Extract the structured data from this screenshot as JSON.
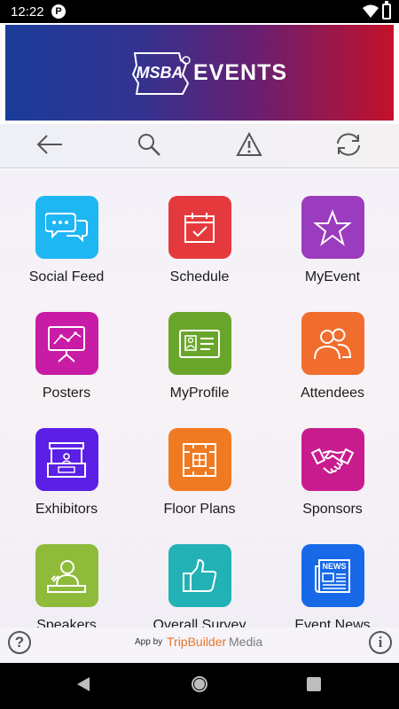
{
  "status_bar": {
    "time": "12:22",
    "app_badge": "P"
  },
  "banner": {
    "logo_text": "MSBA",
    "title": "EVENTS"
  },
  "toolbar": {
    "buttons": [
      {
        "name": "back",
        "icon": "arrow-left-icon"
      },
      {
        "name": "search",
        "icon": "search-icon"
      },
      {
        "name": "alert",
        "icon": "warning-icon"
      },
      {
        "name": "refresh",
        "icon": "sync-icon"
      }
    ]
  },
  "tiles": [
    {
      "label": "Social Feed",
      "color": "#1fb6f4",
      "icon": "chat-bubbles-icon"
    },
    {
      "label": "Schedule",
      "color": "#e53a3d",
      "icon": "calendar-check-icon"
    },
    {
      "label": "MyEvent",
      "color": "#9b3cbe",
      "icon": "star-icon"
    },
    {
      "label": "Posters",
      "color": "#c81ba6",
      "icon": "presentation-board-icon"
    },
    {
      "label": "MyProfile",
      "color": "#6aa52b",
      "icon": "id-card-icon"
    },
    {
      "label": "Attendees",
      "color": "#f06d2e",
      "icon": "people-icon"
    },
    {
      "label": "Exhibitors",
      "color": "#5b1fe6",
      "icon": "booth-icon"
    },
    {
      "label": "Floor Plans",
      "color": "#f07a22",
      "icon": "floor-plan-icon"
    },
    {
      "label": "Sponsors",
      "color": "#c81c8e",
      "icon": "handshake-icon"
    },
    {
      "label": "Speakers",
      "color": "#8fbb3a",
      "icon": "speaker-icon"
    },
    {
      "label": "Overall Survey",
      "color": "#22b2b5",
      "icon": "thumbs-up-icon"
    },
    {
      "label": "Event News",
      "color": "#1769e8",
      "icon": "newspaper-icon"
    }
  ],
  "footer": {
    "help": "?",
    "app_by": "App by",
    "brand_part1": "TripBuilder",
    "brand_part2": "Media",
    "info": "i"
  }
}
